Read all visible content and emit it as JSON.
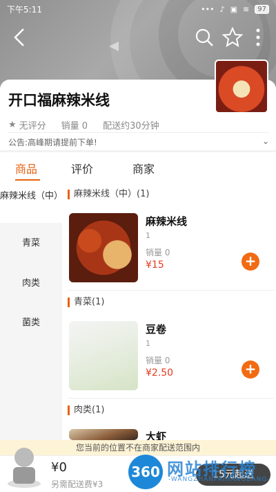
{
  "status_bar": {
    "time": "下午5:11",
    "battery": "97"
  },
  "nav": {
    "back_icon": "back-arrow-icon",
    "search_icon": "search-icon",
    "favorite_icon": "star-icon",
    "more_icon": "more-vertical-icon"
  },
  "shop": {
    "name": "开口福麻辣米线",
    "rating": "无评分",
    "sales": "销量 0",
    "delivery_time": "配送约30分钟",
    "notice": "公告:高峰期请提前下单!"
  },
  "tabs": [
    {
      "label": "商品",
      "active": true
    },
    {
      "label": "评价",
      "active": false
    },
    {
      "label": "商家",
      "active": false
    }
  ],
  "categories": [
    {
      "label": "麻辣米线（中）",
      "active": true
    },
    {
      "label": "青菜",
      "active": false
    },
    {
      "label": "肉类",
      "active": false
    },
    {
      "label": "菌类",
      "active": false
    }
  ],
  "sections": [
    {
      "title": "麻辣米线（中）(1)",
      "dish": {
        "name": "麻辣米线",
        "desc": "1",
        "sales": "销量 0",
        "price": "¥15"
      }
    },
    {
      "title": "青菜(1)",
      "dish": {
        "name": "豆卷",
        "desc": "1",
        "sales": "销量 0",
        "price": "¥2.50"
      }
    },
    {
      "title": "肉类(1)",
      "dish": {
        "name": "大虾"
      }
    }
  ],
  "add_label": "+",
  "warning": "您当前的位置不在商家配送范围内",
  "cart": {
    "total": "¥0",
    "delivery_fee": "另需配送费¥3",
    "checkout": "15元起送"
  },
  "watermark": {
    "logo": "360",
    "text": "网站排行榜",
    "sub": "-WANGZHANPAIHANGBANG-"
  },
  "colors": {
    "accent": "#e8600f",
    "price": "#e53a1f",
    "add_button": "#f26a12",
    "checkout_button": "#444444"
  }
}
